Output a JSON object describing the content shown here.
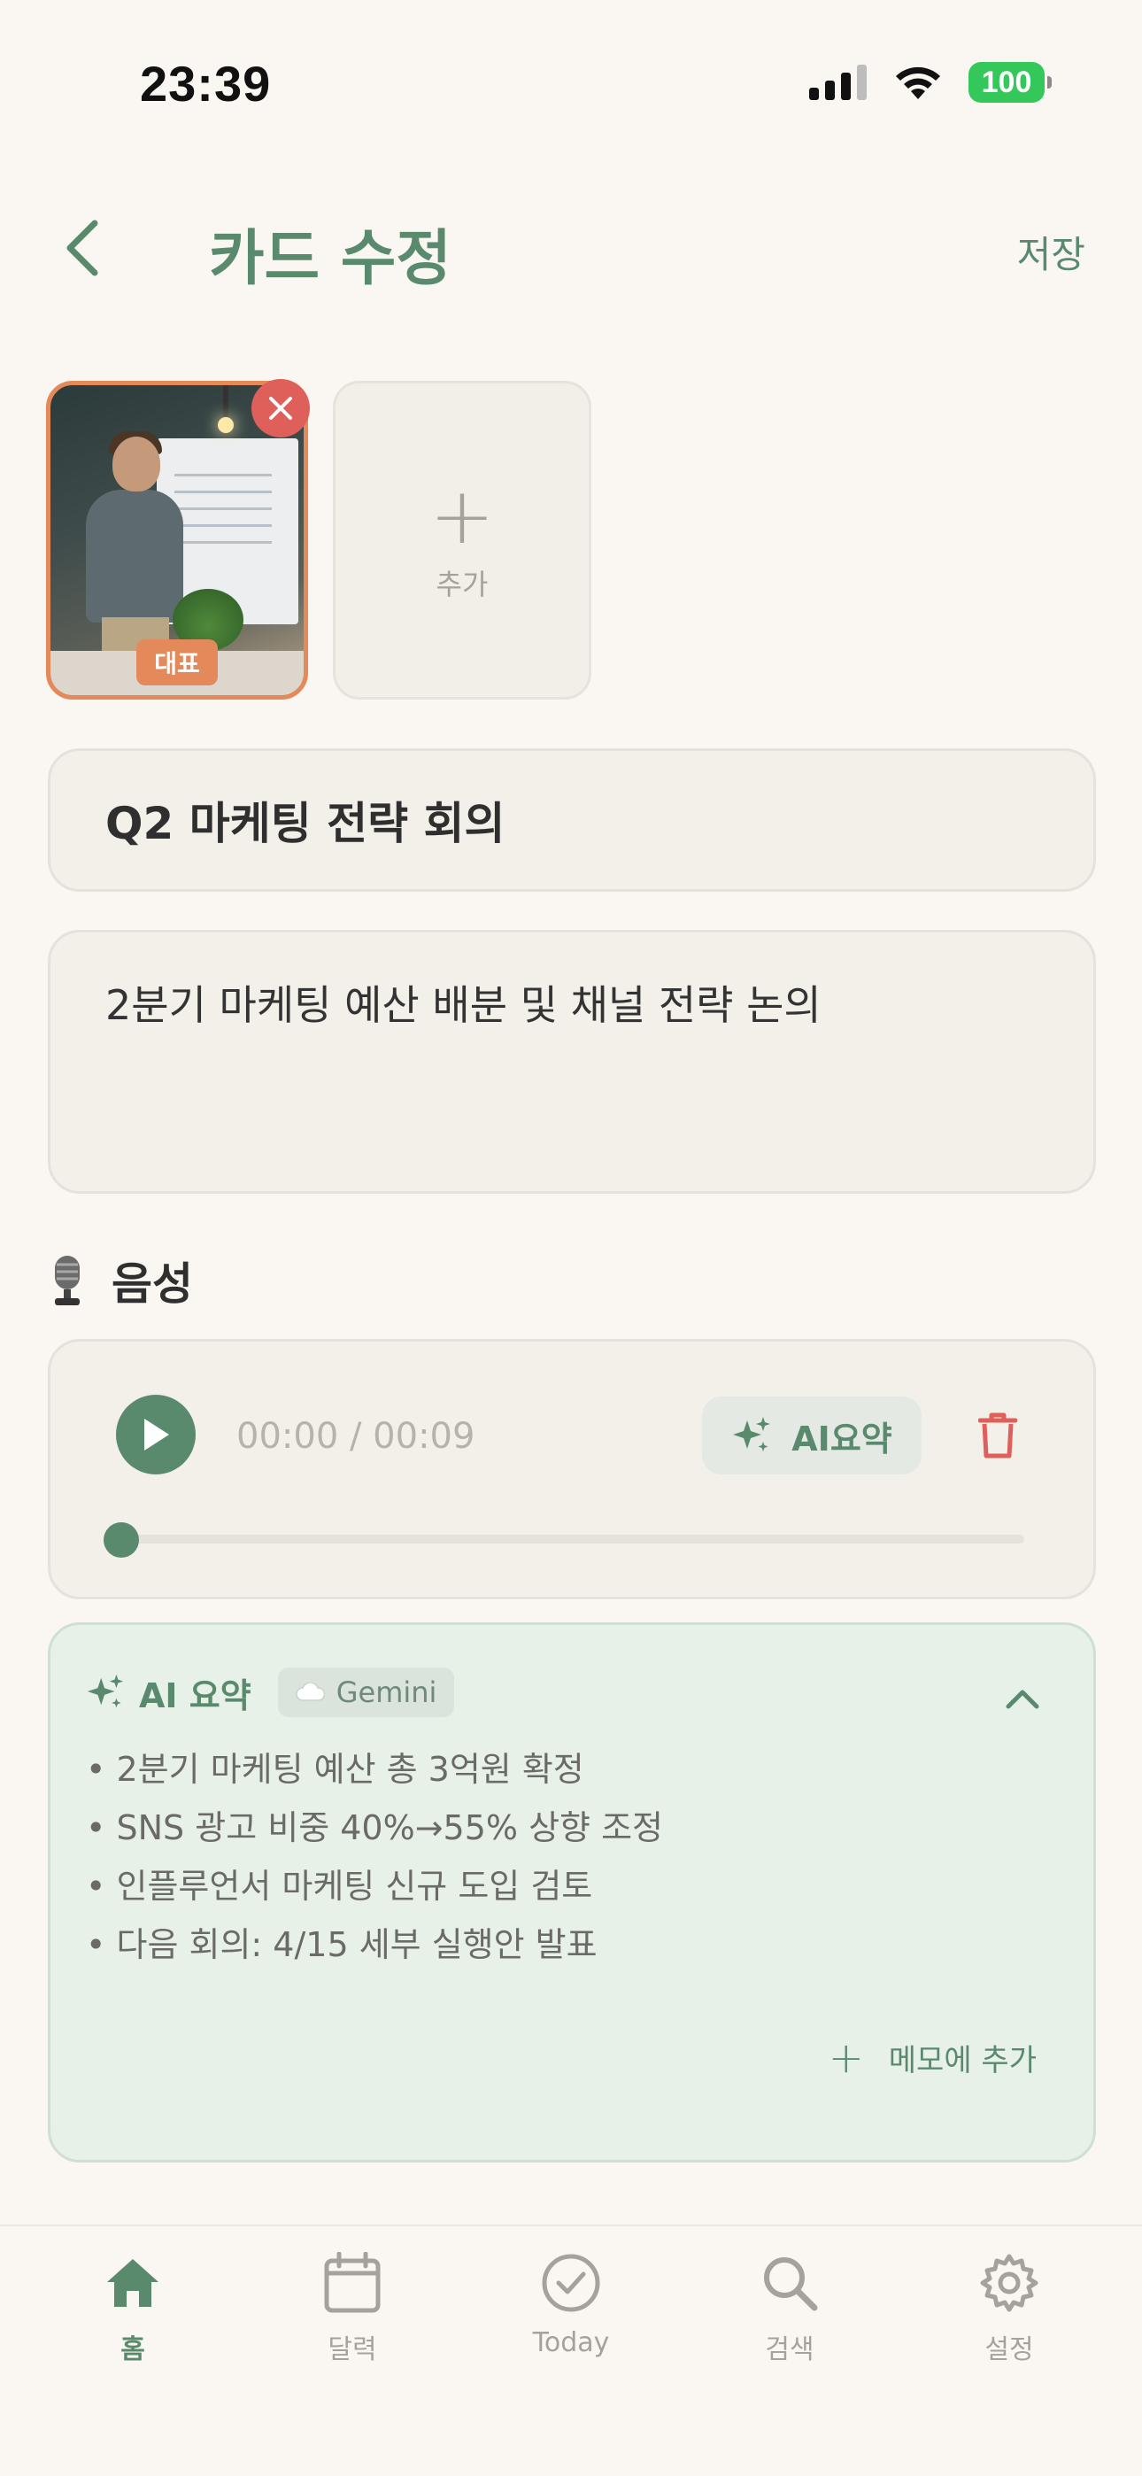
{
  "status_bar": {
    "time": "23:39",
    "battery": "100"
  },
  "header": {
    "title": "카드 수정",
    "save_label": "저장"
  },
  "photos": {
    "rep_badge": "대표",
    "add_label": "추가"
  },
  "card": {
    "title": "Q2 마케팅 전략 회의",
    "description": "2분기 마케팅 예산 배분 및 채널 전략 논의"
  },
  "voice": {
    "section_label": "음성",
    "time_display": "00:00 / 00:09",
    "ai_button_label": "AI요약",
    "progress": 0
  },
  "ai_summary": {
    "title": "AI 요약",
    "model_chip": "Gemini",
    "items": [
      "2분기 마케팅 예산 총 3억원 확정",
      "SNS 광고 비중 40%→55% 상향 조정",
      "인플루언서 마케팅 신규 도입 검토",
      "다음 회의: 4/15 세부 실행안 발표"
    ],
    "add_memo_label": "메모에 추가"
  },
  "tabbar": {
    "items": [
      {
        "label": "홈",
        "icon": "home-icon",
        "active": true
      },
      {
        "label": "달력",
        "icon": "calendar-icon",
        "active": false
      },
      {
        "label": "Today",
        "icon": "check-circle-icon",
        "active": false
      },
      {
        "label": "검색",
        "icon": "search-icon",
        "active": false
      },
      {
        "label": "설정",
        "icon": "gear-icon",
        "active": false
      }
    ]
  },
  "colors": {
    "accent": "#5a8a6e",
    "background": "#faf7f3",
    "danger": "#df5f5a",
    "badge": "#e3895a",
    "ai_card_bg": "#e8f1e8"
  }
}
